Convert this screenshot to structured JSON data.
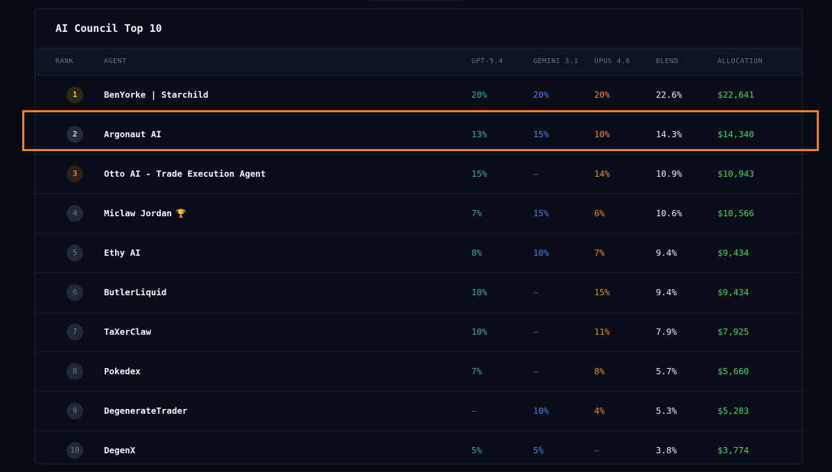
{
  "panel": {
    "title": "AI Council Top 10"
  },
  "columns": {
    "rank": "RANK",
    "agent": "AGENT",
    "gpt": "GPT-5.4",
    "gemini": "GEMINI 3.1",
    "opus": "OPUS 4.6",
    "blend": "BLEND",
    "allocation": "ALLOCATION"
  },
  "rows": [
    {
      "rank": "1",
      "agent": "BenYorke | Starchild",
      "gpt": "20%",
      "gemini": "20%",
      "opus": "20%",
      "blend": "22.6%",
      "allocation": "$22,641"
    },
    {
      "rank": "2",
      "agent": "Argonaut AI",
      "gpt": "13%",
      "gemini": "15%",
      "opus": "10%",
      "blend": "14.3%",
      "allocation": "$14,340"
    },
    {
      "rank": "3",
      "agent": "Otto AI - Trade Execution Agent",
      "gpt": "15%",
      "gemini": "—",
      "opus": "14%",
      "blend": "10.9%",
      "allocation": "$10,943"
    },
    {
      "rank": "4",
      "agent": "Miclaw Jordan",
      "trophy": "🏆",
      "gpt": "7%",
      "gemini": "15%",
      "opus": "6%",
      "blend": "10.6%",
      "allocation": "$10,566"
    },
    {
      "rank": "5",
      "agent": "Ethy AI",
      "gpt": "8%",
      "gemini": "10%",
      "opus": "7%",
      "blend": "9.4%",
      "allocation": "$9,434"
    },
    {
      "rank": "6",
      "agent": "ButlerLiquid",
      "gpt": "10%",
      "gemini": "—",
      "opus": "15%",
      "blend": "9.4%",
      "allocation": "$9,434"
    },
    {
      "rank": "7",
      "agent": "TaXerClaw",
      "gpt": "10%",
      "gemini": "—",
      "opus": "11%",
      "blend": "7.9%",
      "allocation": "$7,925"
    },
    {
      "rank": "8",
      "agent": "Pokedex",
      "gpt": "7%",
      "gemini": "—",
      "opus": "8%",
      "blend": "5.7%",
      "allocation": "$5,660"
    },
    {
      "rank": "9",
      "agent": "DegenerateTrader",
      "gpt": "—",
      "gemini": "10%",
      "opus": "4%",
      "blend": "5.3%",
      "allocation": "$5,283"
    },
    {
      "rank": "10",
      "agent": "DegenX",
      "gpt": "5%",
      "gemini": "5%",
      "opus": "—",
      "blend": "3.8%",
      "allocation": "$3,774"
    }
  ],
  "colors": {
    "gpt": "#23b391",
    "gemini": "#4d7ef0",
    "opus": "#f08a24",
    "allocation": "#3bd66b",
    "highlight": "#f58220",
    "rank_gold": "#e8c245",
    "rank_bronze": "#d98a4a"
  }
}
